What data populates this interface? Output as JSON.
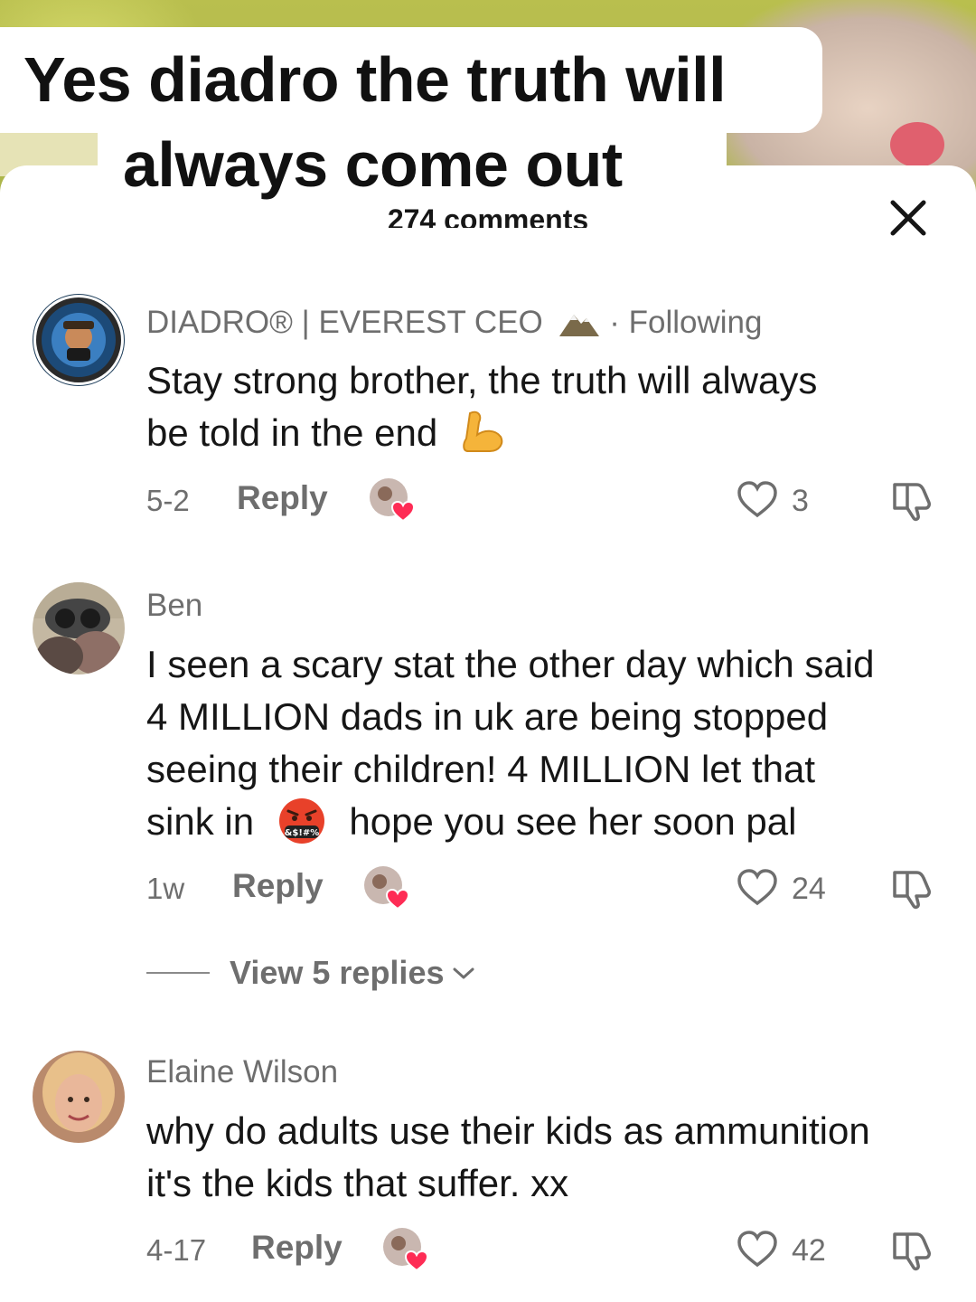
{
  "caption": {
    "line1": "Yes diadro the truth will",
    "line2": "always come out"
  },
  "header": {
    "comments_count": "274 comments",
    "close_icon": "close-icon"
  },
  "comments": [
    {
      "username": "DIADRO® | EVEREST CEO",
      "username_badge_icon": "mountain-icon",
      "follow_status": "· Following",
      "text_line1": "Stay strong brother, the truth will always",
      "text_line2": "be told in the end",
      "emoji_icon": "flexed-biceps-icon",
      "date": "5-2",
      "reply_label": "Reply",
      "likes": "3"
    },
    {
      "username": "Ben",
      "text_line1": "I seen a scary stat the other day which said",
      "text_line2": "4 MILLION dads in uk are being stopped",
      "text_line3": "seeing their children! 4 MILLION let that",
      "text_line4a": "sink in",
      "text_line4b": "hope you see her soon pal",
      "emoji_icon": "cursing-face-icon",
      "date": "1w",
      "reply_label": "Reply",
      "likes": "24",
      "view_replies": "View 5 replies"
    },
    {
      "username": "Elaine Wilson",
      "text_line1": "why do adults use their kids as ammunition",
      "text_line2": "it's the kids that suffer. xx",
      "date": "4-17",
      "reply_label": "Reply",
      "likes": "42"
    }
  ],
  "colors": {
    "text_primary": "#161616",
    "text_secondary": "#6e6e6e",
    "like_heart": "#fe2c55"
  }
}
